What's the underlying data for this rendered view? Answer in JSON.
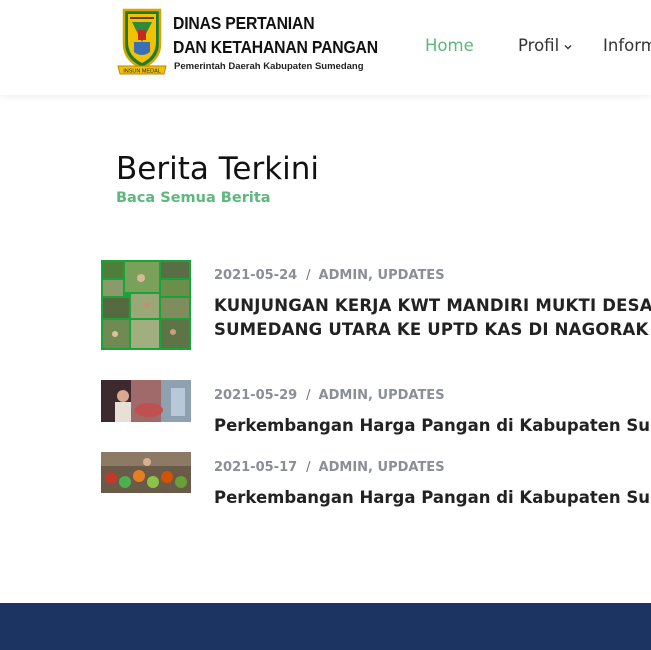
{
  "header": {
    "brand_line1": "DINAS PERTANIAN",
    "brand_line2": "DAN KETAHANAN PANGAN",
    "brand_sub": "Pemerintah Daerah Kabupaten Sumedang",
    "logo_ribbon_text": "INSUN MEDAL",
    "nav": {
      "home": "Home",
      "profil": "Profil",
      "informasi": "Inform"
    }
  },
  "section": {
    "title": "Berita Terkini",
    "read_all": "Baca Semua Berita"
  },
  "news": [
    {
      "date": "2021-05-24",
      "sep": "/",
      "categories": "ADMIN, UPDATES",
      "title_line1": "KUNJUNGAN KERJA KWT MANDIRI MUKTI DESA M",
      "title_line2": "SUMEDANG UTARA KE UPTD KAS DI NAGORAK SU"
    },
    {
      "date": "2021-05-29",
      "sep": "/",
      "categories": "ADMIN, UPDATES",
      "title_line1": "Perkembangan Harga Pangan di Kabupaten Sume"
    },
    {
      "date": "2021-05-17",
      "sep": "/",
      "categories": "ADMIN, UPDATES",
      "title_line1": "Perkembangan Harga Pangan di Kabupaten Sume"
    }
  ],
  "colors": {
    "accent_green": "#5cb87c",
    "footer_navy": "#1c3461",
    "meta_gray": "#8a8f96"
  }
}
